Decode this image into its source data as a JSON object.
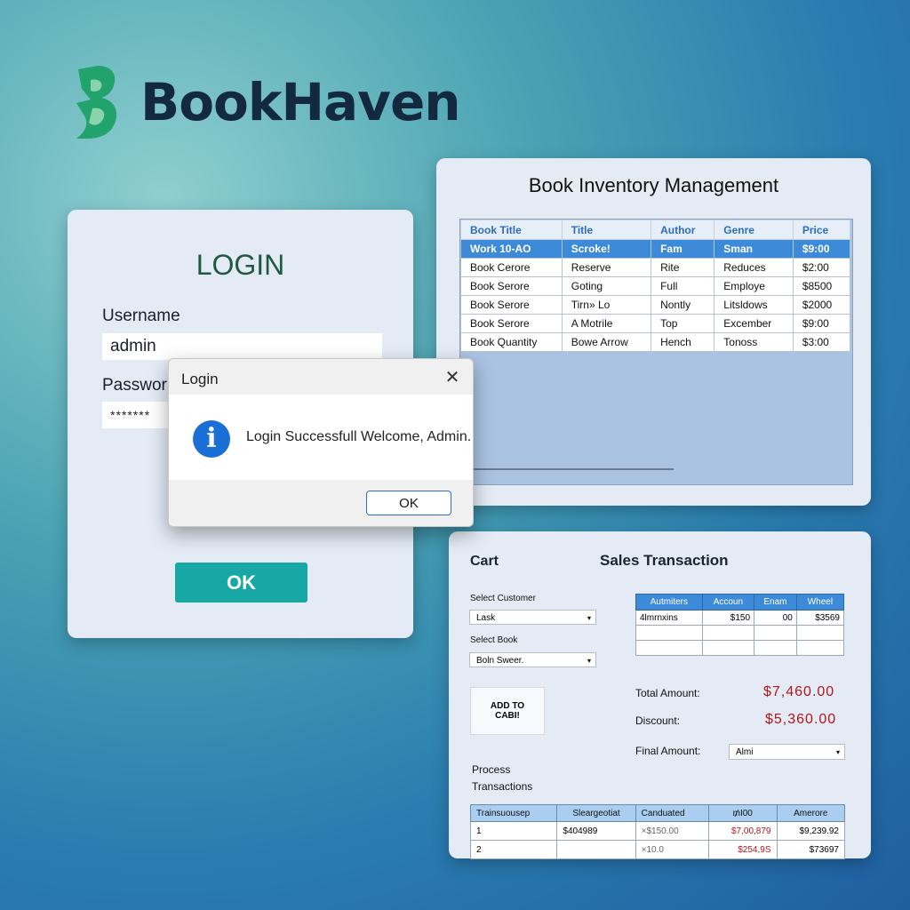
{
  "brand": {
    "name": "BookHaven",
    "colors": {
      "mark": "#21a36b",
      "text": "#12293f"
    }
  },
  "login": {
    "title": "LOGIN",
    "username_label": "Username",
    "username_value": "admin",
    "password_label": "Passwor",
    "password_value": "*******",
    "ok_label": "OK"
  },
  "dialog": {
    "title": "Login",
    "close_icon": "close-icon",
    "info_icon": "info-icon",
    "info_glyph": "i",
    "message": "Login Successfull Welcome, Admin.",
    "ok_label": "OK"
  },
  "inventory": {
    "title": "Book Inventory Management",
    "columns": [
      "Book Title",
      "Title",
      "Author",
      "Genre",
      "Price"
    ],
    "rows": [
      [
        "Work 10-AO",
        "Scroke!",
        "Fam",
        "Sman",
        "$9:00"
      ],
      [
        "Book Cerore",
        "Reserve",
        "Rite",
        "Reduces",
        "$2:00"
      ],
      [
        "Book Serore",
        "Goting",
        "Full",
        "Employe",
        "$8500"
      ],
      [
        "Book Serore",
        "Tirn» Lo",
        "Nontly",
        "Litsldows",
        "$2000"
      ],
      [
        "Book Serore",
        "A Motrile",
        "Top",
        "Excember",
        "$9:00"
      ],
      [
        "Book Quantity",
        "Bowe Arrow",
        "Hench",
        "Tonoss",
        "$3:00"
      ]
    ]
  },
  "sales": {
    "cart_title": "Cart",
    "title": "Sales Transaction",
    "select_customer_label": "Select Customer",
    "select_customer_value": "Lask",
    "select_book_label": "Select Book",
    "select_book_value": "Boln Sweer.",
    "add_to_cart_line1": "ADD TO",
    "add_to_cart_line2": "CABI!",
    "cart_columns": [
      "Autmiters",
      "Accoun",
      "Enam",
      "Wheel"
    ],
    "cart_rows": [
      [
        "4lmrnxins",
        "$150",
        "00",
        "$3569"
      ],
      [
        "",
        "",
        "",
        ""
      ],
      [
        "",
        "",
        "",
        ""
      ]
    ],
    "total_label": "Total Amount:",
    "total_value": "$7,460.00",
    "discount_label": "Discount:",
    "discount_value": "$5,360.00",
    "final_label": "Final Amount:",
    "final_value": "Almi",
    "process_line1": "Process",
    "process_line2": "Transactions",
    "tx_columns": [
      "Trainsuousep",
      "Sleargeotiat",
      "Canduated",
      "₥I00",
      "Amerore"
    ],
    "tx_rows": [
      [
        "1",
        "$404989",
        "×$150.00",
        "$7,00,879",
        "$9,239.92"
      ],
      [
        "2",
        "",
        "×10.0",
        "$254,9S",
        "$73697"
      ]
    ]
  }
}
